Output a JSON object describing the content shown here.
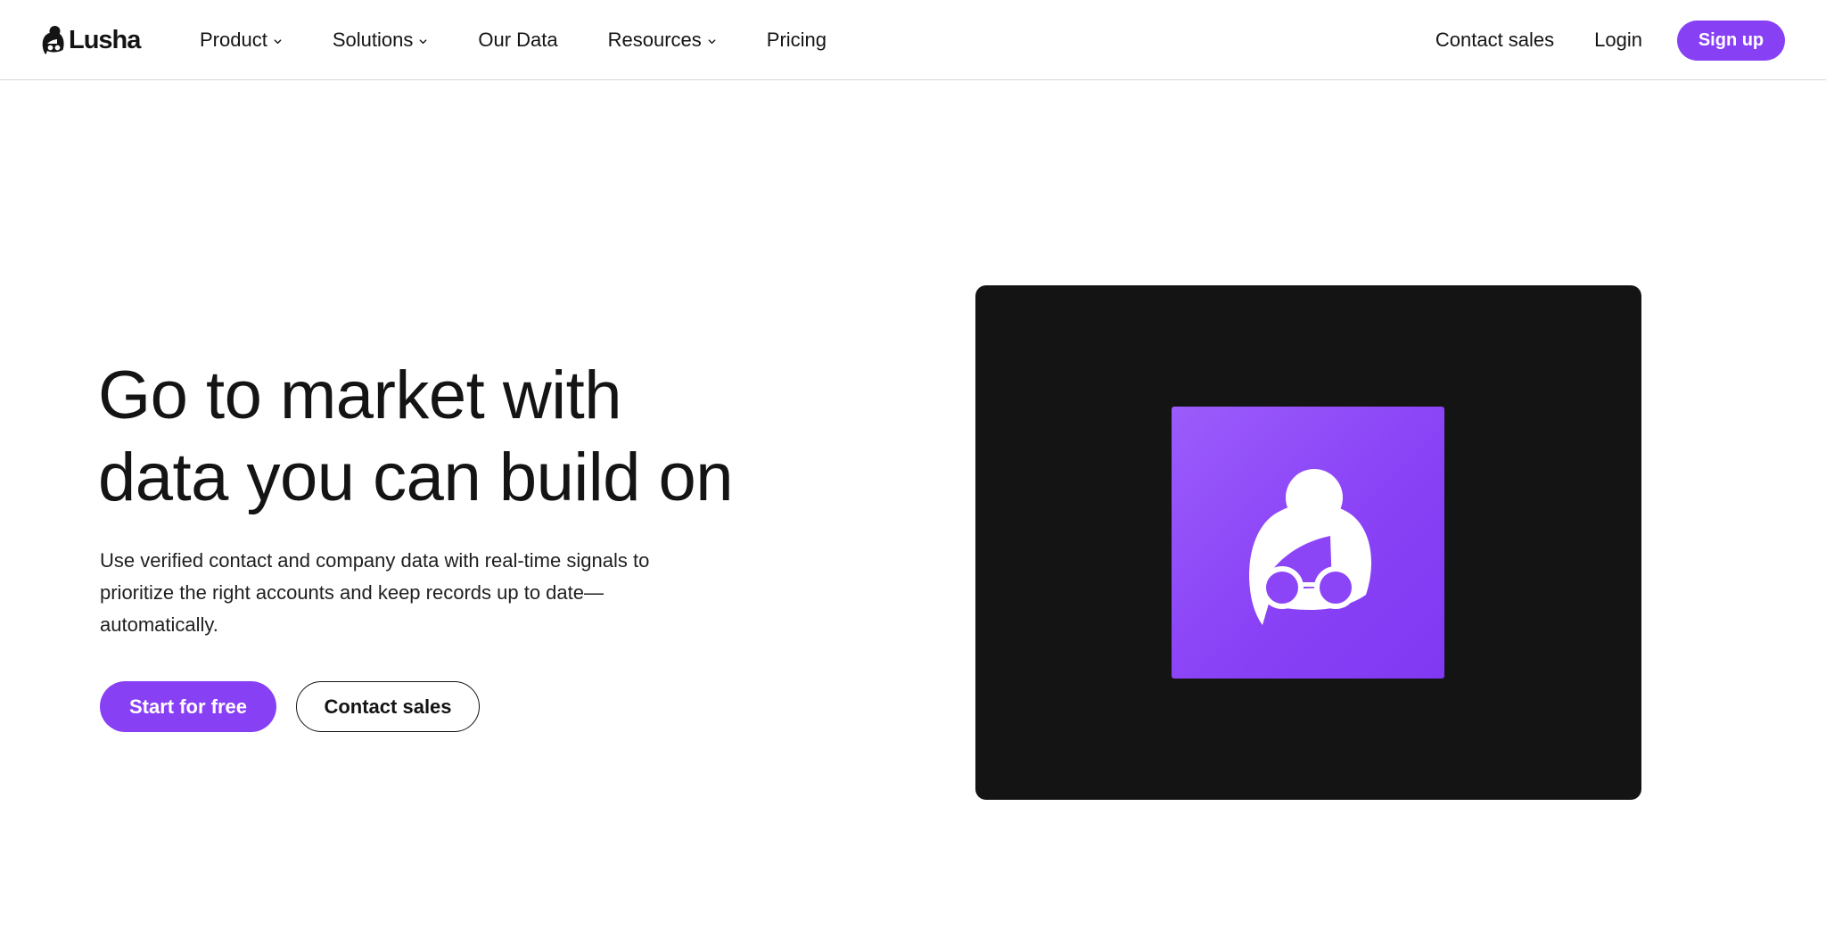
{
  "header": {
    "logo_text": "Lusha",
    "nav": [
      {
        "label": "Product",
        "has_dropdown": true
      },
      {
        "label": "Solutions",
        "has_dropdown": true
      },
      {
        "label": "Our Data",
        "has_dropdown": false
      },
      {
        "label": "Resources",
        "has_dropdown": true
      },
      {
        "label": "Pricing",
        "has_dropdown": false
      }
    ],
    "contact_sales": "Contact sales",
    "login": "Login",
    "signup": "Sign up"
  },
  "hero": {
    "title_line1": "Go to market with",
    "title_line2": "data you can build on",
    "subtitle": "Use verified contact and company data with real-time signals to prioritize the right accounts and keep records up to date—automatically.",
    "cta_primary": "Start for free",
    "cta_secondary": "Contact sales"
  },
  "media": {
    "icon": "lusha-mascot-icon"
  },
  "colors": {
    "brand_purple": "#8840f5",
    "text": "#141414",
    "media_bg": "#141414"
  }
}
